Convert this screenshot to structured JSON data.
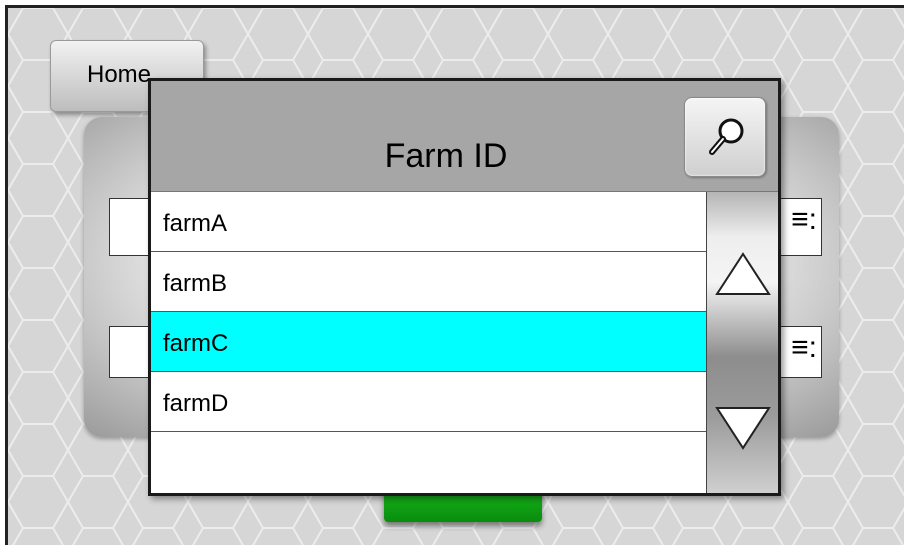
{
  "screen": {
    "home_label": "Home"
  },
  "background": {
    "field_indicator": "≡:"
  },
  "dialog": {
    "title": "Farm ID",
    "search_icon": "magnifier-icon",
    "items": [
      {
        "label": "farmA",
        "selected": false
      },
      {
        "label": "farmB",
        "selected": false
      },
      {
        "label": "farmC",
        "selected": true
      },
      {
        "label": "farmD",
        "selected": false
      },
      {
        "label": "",
        "selected": false
      }
    ],
    "scroll_up_icon": "triangle-up-icon",
    "scroll_down_icon": "triangle-down-icon"
  },
  "colors": {
    "selected_row": "#00ffff",
    "header_bg": "#a6a6a6",
    "go_button": "#12b017"
  }
}
